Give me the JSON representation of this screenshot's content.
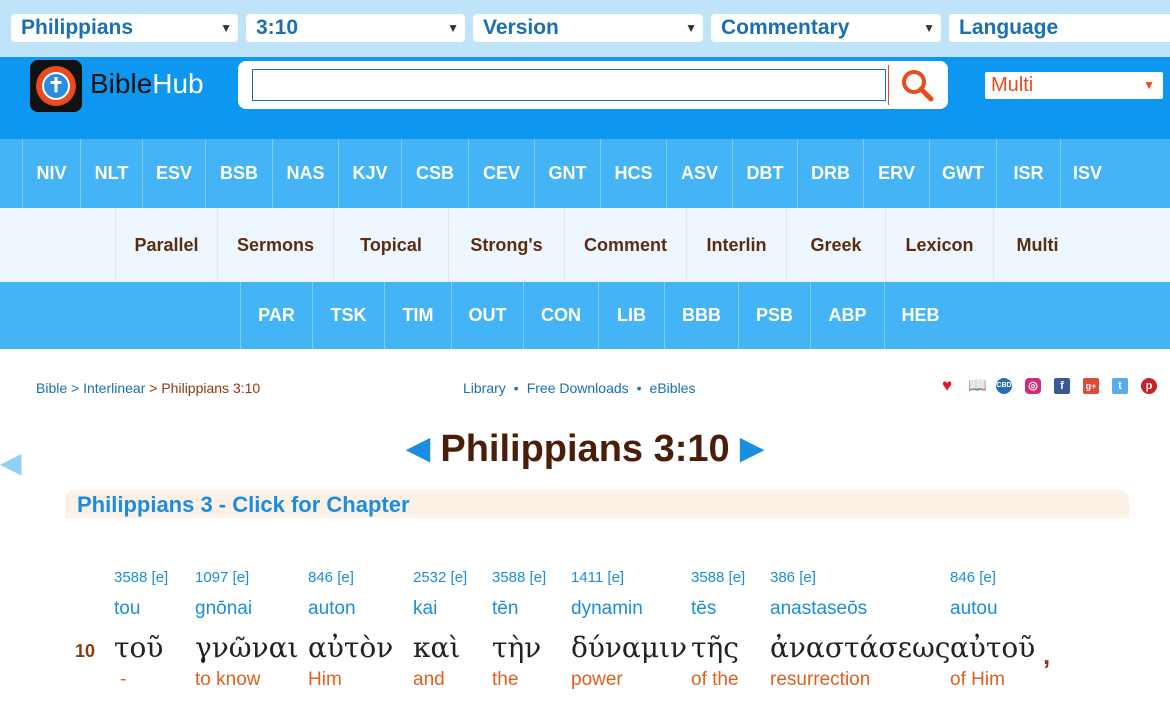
{
  "top_selectors": [
    {
      "label": "Philippians"
    },
    {
      "label": "3:10"
    },
    {
      "label": "Version"
    },
    {
      "label": "Commentary"
    },
    {
      "label": "Language"
    }
  ],
  "brand": {
    "bible": "Bible",
    "hub": "Hub"
  },
  "search": {
    "value": "",
    "placeholder": ""
  },
  "language_select": {
    "value": "Multi"
  },
  "versions": [
    "NIV",
    "NLT",
    "ESV",
    "BSB",
    "NAS",
    "KJV",
    "CSB",
    "CEV",
    "GNT",
    "HCS",
    "ASV",
    "DBT",
    "DRB",
    "ERV",
    "GWT",
    "ISR",
    "ISV"
  ],
  "tools": [
    "Parallel",
    "Sermons",
    "Topical",
    "Strong's",
    "Comment",
    "Interlin",
    "Greek",
    "Lexicon",
    "Multi"
  ],
  "sources": [
    "PAR",
    "TSK",
    "TIM",
    "OUT",
    "CON",
    "LIB",
    "BBB",
    "PSB",
    "ABP",
    "HEB"
  ],
  "breadcrumb": {
    "bible": "Bible",
    "sep1": " > ",
    "interlinear": "Interlinear",
    "sep2": " > ",
    "current": "Philippians 3:10"
  },
  "links": {
    "library": "Library",
    "downloads": "Free Downloads",
    "ebibles": "eBibles"
  },
  "page_title": "Philippians 3:10",
  "chapter_link": "Philippians 3 - Click for Chapter",
  "verse": {
    "number": "10",
    "trailing_punct": ",",
    "words": [
      {
        "strongs": "3588 [e]",
        "translit": "tou",
        "greek": "τοῦ",
        "english": "-"
      },
      {
        "strongs": "1097 [e]",
        "translit": "gnōnai",
        "greek": "γνῶναι",
        "english": "to know"
      },
      {
        "strongs": "846 [e]",
        "translit": "auton",
        "greek": "αὐτὸν",
        "english": "Him"
      },
      {
        "strongs": "2532 [e]",
        "translit": "kai",
        "greek": "καὶ",
        "english": "and"
      },
      {
        "strongs": "3588 [e]",
        "translit": "tēn",
        "greek": "τὴν",
        "english": "the"
      },
      {
        "strongs": "1411 [e]",
        "translit": "dynamin",
        "greek": "δύναμιν",
        "english": "power"
      },
      {
        "strongs": "3588 [e]",
        "translit": "tēs",
        "greek": "τῆς",
        "english": "of the"
      },
      {
        "strongs": "386 [e]",
        "translit": "anastaseōs",
        "greek": "ἀναστάσεως",
        "english": "resurrection"
      },
      {
        "strongs": "846 [e]",
        "translit": "autou",
        "greek": "αὐτοῦ",
        "english": "of Him"
      }
    ]
  },
  "colors": {
    "accent_blue": "#0d97f0",
    "nav_blue": "#45b4f7",
    "brown": "#5a2c12",
    "orange": "#e0601e"
  }
}
